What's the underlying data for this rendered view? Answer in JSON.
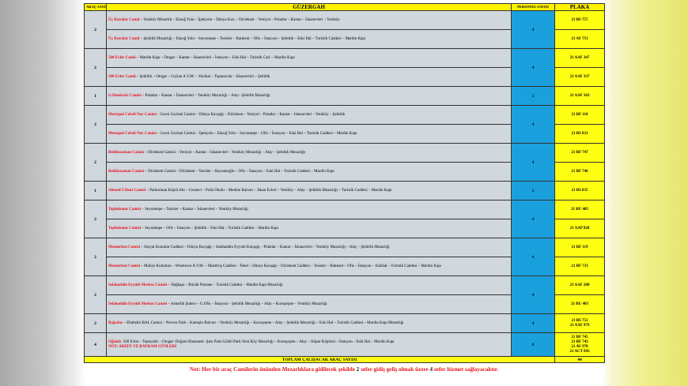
{
  "header": {
    "arac": "ARAÇ SAYISI",
    "guzergah": "GÜZERGAH",
    "personel": "PERSONEL SAYISI",
    "plaka": "PLAKA"
  },
  "groups": [
    {
      "arac": "2",
      "personel": "4",
      "routes": [
        {
          "mosque": "Üç Kuyular Camii",
          "text": " – Yeniköy Mezarlık – Elazığ Yolu – İpekyolu – Dünya Kav. – Diclekent – Yeniyol – Polatlar – Kantar – İskanevleri – Yeniköy",
          "plates": [
            "21 BS 757"
          ]
        },
        {
          "mosque": "Üç Kuyular Camii",
          "text": " – Şehitlik Mezarlığı – Elazığ Yolu – Seyrantepe – Tesisler – Batıkent – Ofis – İstasyon – Şehitlik – Eski Hal – Turistik Caddesi – Mardin Kapı",
          "plates": [
            "21 AF 751"
          ]
        }
      ]
    },
    {
      "arac": "2",
      "personel": "4",
      "routes": [
        {
          "mosque": "500 Evler Camii",
          "text": " – Mardin Kapı – Otogar – Kantar – İskanevleri – İstasyon – Eski Hal – Turistik Cad. – Mardin Kapı",
          "plates": [
            "21 AAF 347"
          ]
        },
        {
          "mosque": "500 Evler Camii",
          "text": " – Şehitlik – Otogar – Ceylan A.V.M. – Yenihal – Toptancılar – İskanevleri – Şehitlik",
          "plates": [
            "21 AAF 337"
          ]
        }
      ]
    },
    {
      "arac": "1",
      "personel": "2",
      "routes": [
        {
          "mosque": "G.Demirsöz Camisi",
          "text": " – Polatlar – Kantar – İskanevleri – Yeniköy Mezarlığı – Alay– Şehitlik Mezarlığı",
          "plates": [
            "21 AAF 343"
          ]
        }
      ]
    },
    {
      "arac": "2",
      "personel": "4",
      "routes": [
        {
          "mosque": "Metropol Cebeli Nur Camisi",
          "text": " – Gavsi Geylani Camisi – Dünya Kavşağı – Diclekent – Yeniyol – Polatlar – Kantar – İskanevleri – Yeniköy – Şehitlik",
          "plates": [
            "21 BF 118"
          ]
        },
        {
          "mosque": "Metropol Cebeli Nur Camisi",
          "text": " – Gavsi Geylani Camisi – İpekyolu – Elazığ Yolu – Seyrantepe – Ofis – İstasyon – Eski Hal – Turistik Caddesi – Mardin Kapı",
          "plates": [
            "21 BS 831"
          ]
        }
      ]
    },
    {
      "arac": "2",
      "personel": "4",
      "routes": [
        {
          "mosque": "Bediüzzaman Camisi",
          "text": " – Diclekent Camisi – Yeniyol – Kantar – İskanevleri – Yeniköy Mezarlığı – Alay – Şehitlik Mezarlığı",
          "plates": [
            "21 BF 747"
          ]
        },
        {
          "mosque": "Bediüzzaman Camisi",
          "text": " – Diclekent Camisi – Diclekent – Tesisler – Bayramoğlu – Ofis – İstasyon – Eski Hal – Turistik Caddesi – Mardin Kapı",
          "plates": [
            "21 BF 746"
          ]
        }
      ]
    },
    {
      "arac": "1",
      "personel": "2",
      "routes": [
        {
          "mosque": "Ahmed-İ Hani Camisi",
          "text": " – Parkorman Köprü Altı – Cezaevi – Polis Okulu – Medine Bulvarı – İskan Evleri – Yeniköy – Alay – Şehitlik Mezarlığı – Turistik Caddesi – Mardin Kapı",
          "plates": [
            "21 BS 835"
          ]
        }
      ]
    },
    {
      "arac": "2",
      "personel": "4",
      "routes": [
        {
          "mosque": "Toplukonut Camisi",
          "text": " – Seyrantepe – Tesisler – Kantar – İskanevleri – Yeniköy Mezarlığı",
          "plates": [
            "21 BU 405"
          ]
        },
        {
          "mosque": "Toplukonut Camisi",
          "text": " – Seyrantepe – Ofis – İstasyon – Şehitlik – Eski Hal – Turistik Caddesi – Mardin Kapı",
          "plates": [
            "21 AAP 020"
          ]
        }
      ]
    },
    {
      "arac": "2",
      "personel": "4",
      "routes": [
        {
          "mosque": "Memurken Camisi",
          "text": " – Sosyal Konutlar Caddesi – Dünya Kavşağı – Selahaddin Eyyubi Kavşağı – Polatlar – Kantar – İskanevleri – Yeniköy Mezarlığı – Alay – Şehitlik Mezarlığı",
          "plates": [
            "21 BF 119"
          ]
        },
        {
          "mosque": "Memurken Camisi",
          "text": " – Maliye Konutları – Winetown A.V.M. – Mastfroş Caddesi – Tekel – Dünya Kavşağı – Diclekent Caddesi – Tesisler – Batıkent – Ofis – İstasyon – Eskihal – Turistik Caddesi – Mardin Kapı",
          "plates": [
            "21 BF 733"
          ]
        }
      ]
    },
    {
      "arac": "2",
      "personel": "4",
      "routes": [
        {
          "mosque": "Selahaddin Eyyubi Merkez Camisi",
          "text": " – Dağkapı – Büyük Postane – Turistik Caddesi – Mardin Kapı Mezarlığı",
          "plates": [
            "21 AAF 200"
          ]
        },
        {
          "mosque": "Selahaddin Eyyubi Merkez Camisi",
          "text": " – Askerlik Şubesi – G.Ofis – İstasyon – Şehitlik Mezarlığı – Alay – Kuruçeşme – Yeniköy Mezarlığı",
          "plates": [
            "21 BU 403"
          ]
        }
      ]
    },
    {
      "arac": "2",
      "personel": "4",
      "routes": [
        {
          "mosque": "Bağcılar",
          "text": " – Ebubekir BAL Camisi – Nevroz Park – Kamışlo Bulvarı – Yeniköy Mezarlığı – Kuruçeşme – Alay – Şehitlik Mezarlığı – Eski Hal – Turistik Caddesi – Mardin Kapı Mezarlığı",
          "plates": [
            "21 BS 751",
            "21 AAF 979"
          ]
        }
      ]
    },
    {
      "arac": "4",
      "personel": "8",
      "routes": [
        {
          "mosque": "Oğlaklı",
          "text": "- 500 Evler – Tepeyehir – Otogar- Doğum Hastanesi- Şato Park-Göleli Park-Yeni Köy Mezarlığı – Kuruçeşme – Alay – Alipar Köprüsü – İstasyon – Eski Hal – Mardin Kapı",
          "note": "NOT: AREFE VE BAYRAM GÜNLERİ",
          "plates": [
            "21 BF 745",
            "21 BF 743",
            "21 AV 970",
            "21 ACT 892"
          ]
        }
      ]
    }
  ],
  "total": {
    "label": "TOPLAM ÇALIŞACAK ARAÇ SAYISI",
    "value": "44"
  },
  "footnote": {
    "part1": "Not: Her bir araç Camilerin önünden Mezarlıklara gidilecek şekilde ",
    "num1": "2",
    "part2": " sefer gidiş geliş olmak üzere ",
    "num2": "4",
    "part3": " sefer hizmet sağlayacaktır."
  },
  "colors": {
    "header_yellow": "#fff200",
    "route_gray": "#d0d7dd",
    "personnel_blue": "#1aa0dd",
    "plate_yellow": "#ffff14",
    "mosque_red": "#e8111d"
  }
}
